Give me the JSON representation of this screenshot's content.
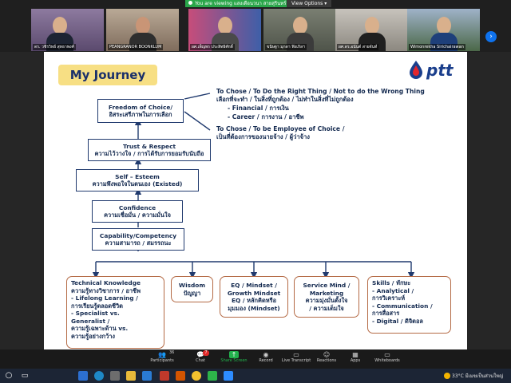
{
  "banner": {
    "viewing_text": "You are viewing แสงเดือนวนา สายสุรินทร์'s screen",
    "view_options": "View Options ▾"
  },
  "participants": [
    {
      "name": "ดร. วชิรวิทย์ สุทธาพงศ์"
    },
    {
      "name": "PEANGRANOR BOONKLUM"
    },
    {
      "name": "ผศ.เพ็ญพร ประสิทธิศักดิ์"
    },
    {
      "name": "ขนิษฐา มุกดา ฟิงเกิลฯ"
    },
    {
      "name": "ผศ.ดร.อนันต์ สายจันท์"
    },
    {
      "name": "Wimonrekha Sirichairawan"
    }
  ],
  "slide": {
    "title": "My Journey",
    "logo_text": "ptt",
    "chain": [
      {
        "line1": "Freedom of Choice/",
        "line2": "อิสระเสรีภาพในการเลือก"
      },
      {
        "line1": "Trust & Respect",
        "line2": "ความไว้วางใจ / การได้รับการยอมรับนับถือ"
      },
      {
        "line1": "Self – Esteem",
        "line2": "ความพึงพอใจในตนเอง (Existed)"
      },
      {
        "line1": "Confidence",
        "line2": "ความเชื่อมั่น / ความมั่นใจ"
      },
      {
        "line1": "Capability/Competency",
        "line2": "ความสามารถ / สมรรถนะ"
      }
    ],
    "notes": [
      "To Chose / To Do the Right Thing / Not to do the Wrong Thing",
      "เลือกที่จะทำ / ในสิ่งที่ถูกต้อง / ไม่ทำในสิ่งที่ไม่ถูกต้อง",
      "-     Financial / การเงิน",
      "-     Career / การงาน / อาชีพ",
      "To Chose / To be Employee of Choice /",
      "เป็นที่ต้องการของนายจ้าง / ผู้ว่าจ้าง"
    ],
    "foundations": [
      {
        "lines": [
          "Technical Knowledge",
          "ความรู้ทางวิชาการ / อาชีพ",
          "-  Lifelong Learning /",
          "   การเรียนรู้ตลอดชีวิต",
          "-  Specialist vs.",
          "   Generalist /",
          "   ความรู้เฉพาะด้าน vs.",
          "   ความรู้อย่างกว้าง"
        ]
      },
      {
        "lines": [
          "Wisdom",
          "ปัญญา"
        ]
      },
      {
        "lines": [
          "EQ / Mindset /",
          "Growth Mindset",
          "EQ / หลักคิดหรือ",
          "มุมมอง (Mindset)"
        ]
      },
      {
        "lines": [
          "Service Mind /",
          "Marketing",
          "ความมุ่งมั่นตั้งใจ",
          "/ ความเต็มใจ"
        ]
      },
      {
        "lines": [
          "Skills / ทักษะ",
          "-  Analytical /",
          "   การวิเคราะห์",
          "-  Communication /",
          "   การสื่อสาร",
          "-  Digital / ดิจิตอล"
        ]
      }
    ]
  },
  "toolbar": {
    "participants_count": "36",
    "participants": "Participants",
    "chat_badge": "7",
    "chat": "Chat",
    "share_screen": "Share Screen",
    "record": "Record",
    "live_transcript": "Live Transcript",
    "reactions": "Reactions",
    "apps": "Apps",
    "whiteboards": "Whiteboards"
  },
  "taskbar": {
    "weather": "33°C  มีเมฆเป็นส่วนใหญ่"
  },
  "colors": {
    "accent_green": "#22b14c",
    "slide_navy": "#13294f",
    "title_yellow": "#f7df84",
    "round_border": "#b46a45"
  }
}
